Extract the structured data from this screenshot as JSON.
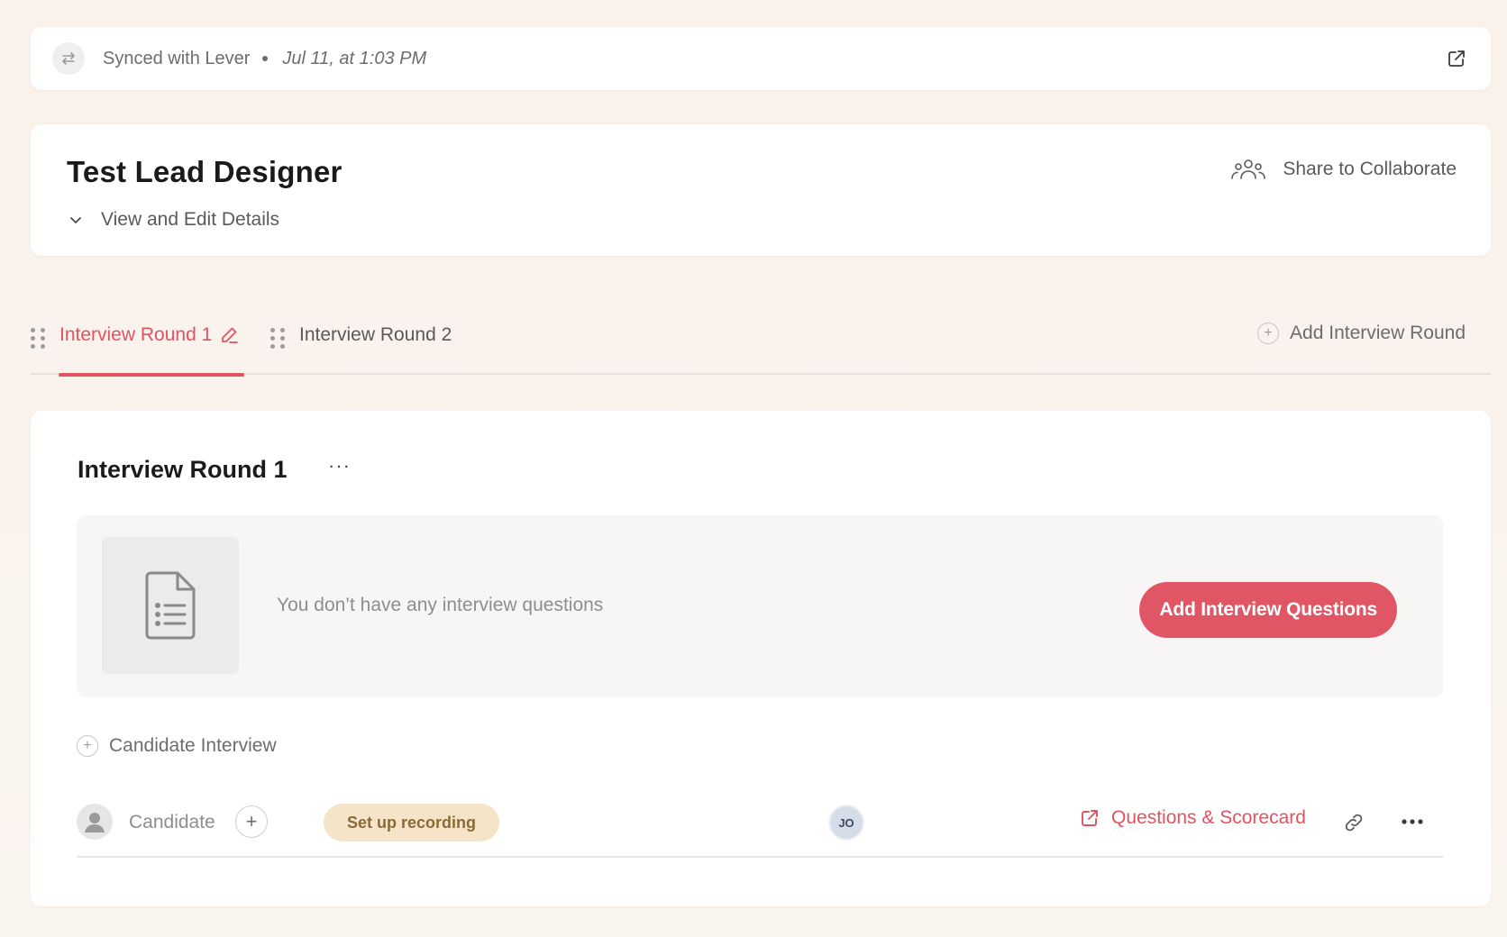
{
  "sync": {
    "text": "Synced with Lever",
    "date": "Jul 11, at 1:03 PM",
    "icon": "sync-arrows-icon",
    "open_icon": "external-link-icon"
  },
  "header": {
    "title": "Test Lead Designer",
    "details_label": "View and Edit Details",
    "share_label": "Share to Collaborate"
  },
  "tabs": [
    {
      "label": "Interview Round 1",
      "active": true
    },
    {
      "label": "Interview Round 2",
      "active": false
    }
  ],
  "add_round_label": "Add Interview Round",
  "round": {
    "title": "Interview Round 1",
    "menu_label": "···",
    "empty_text": "You don’t have any interview questions",
    "add_questions_label": "Add Interview Questions",
    "candidate_interview_label": "Candidate Interview",
    "row": {
      "candidate_label": "Candidate",
      "recording_label": "Set up recording",
      "interviewer_initials": "JO",
      "scorecard_label": "Questions & Scorecard"
    }
  },
  "colors": {
    "accent": "#e0535f",
    "recording_badge_bg": "#f6e4c9",
    "recording_badge_text": "#8a6a36",
    "background": "#f9f2ec"
  }
}
